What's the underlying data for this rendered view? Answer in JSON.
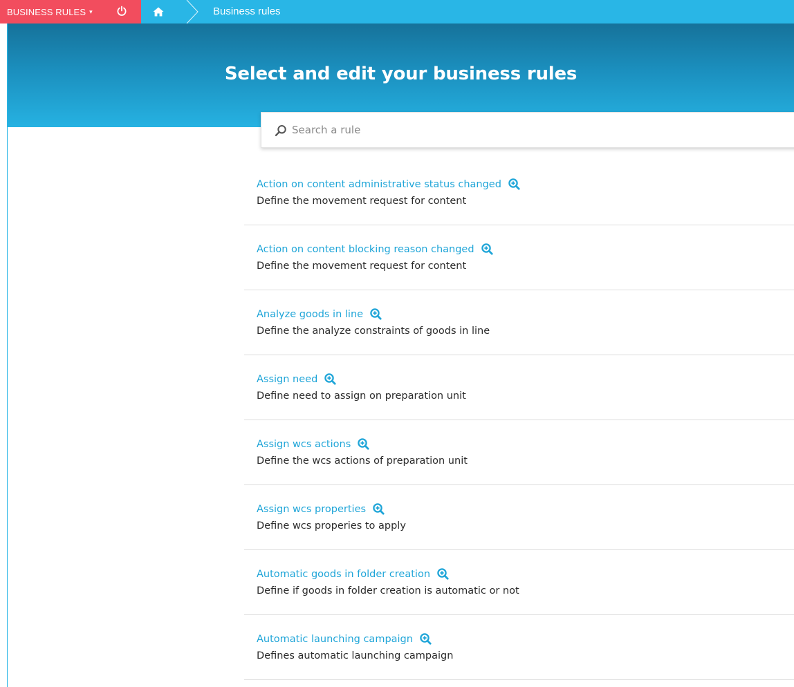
{
  "header": {
    "app_menu_label": "BUSINESS RULES",
    "caret": "▾",
    "breadcrumb": "Business rules"
  },
  "hero": {
    "title": "Select and edit your business rules"
  },
  "search": {
    "placeholder": "Search a rule",
    "value": ""
  },
  "rules": [
    {
      "title": "Action on content administrative status changed",
      "description": "Define the movement request for content"
    },
    {
      "title": "Action on content blocking reason changed",
      "description": "Define the movement request for content"
    },
    {
      "title": "Analyze goods in line",
      "description": "Define the analyze constraints of goods in line"
    },
    {
      "title": "Assign need",
      "description": "Define need to assign on preparation unit"
    },
    {
      "title": "Assign wcs actions",
      "description": "Define the wcs actions of preparation unit"
    },
    {
      "title": "Assign wcs properties",
      "description": "Define wcs properies to apply"
    },
    {
      "title": "Automatic goods in folder creation",
      "description": "Define if goods in folder creation is automatic or not"
    },
    {
      "title": "Automatic launching campaign",
      "description": "Defines automatic launching campaign"
    }
  ],
  "colors": {
    "accent": "#29b6e6",
    "app_menu": "#f24d5e",
    "link": "#1fa5d8"
  },
  "icons": {
    "power": "power-icon",
    "home": "home-icon",
    "search": "search-icon",
    "zoom": "zoom-in-icon"
  }
}
